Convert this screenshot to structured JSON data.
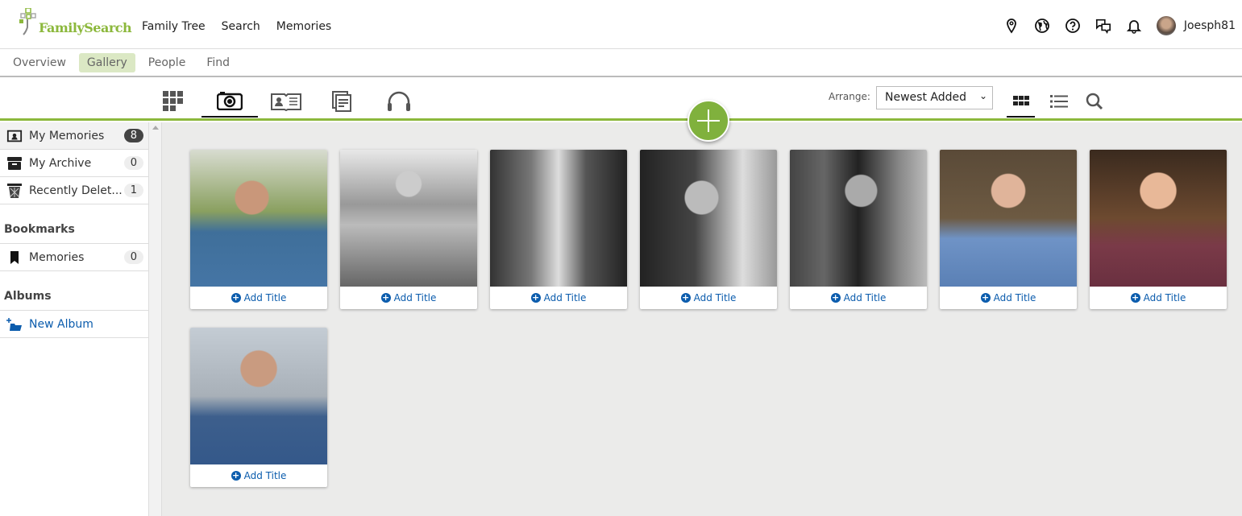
{
  "header": {
    "logo": "FamilySearch",
    "nav": [
      "Family Tree",
      "Search",
      "Memories"
    ],
    "user": "Joesph81",
    "icons": [
      "location-pin-icon",
      "globe-icon",
      "help-icon",
      "chat-icon",
      "bell-icon"
    ]
  },
  "subnav": {
    "items": [
      "Overview",
      "Gallery",
      "People",
      "Find"
    ],
    "active": "Gallery"
  },
  "toolbar": {
    "types": [
      "all-icon",
      "photo-icon",
      "story-icon",
      "document-icon",
      "audio-icon"
    ],
    "arrange_label": "Arrange:",
    "arrange_value": "Newest Added"
  },
  "sidebar": {
    "items": [
      {
        "label": "My Memories",
        "count": "8"
      },
      {
        "label": "My Archive",
        "count": "0"
      },
      {
        "label": "Recently Delet...",
        "count": "1"
      }
    ],
    "bookmarks_heading": "Bookmarks",
    "bookmarks": [
      {
        "label": "Memories",
        "count": "0"
      }
    ],
    "albums_heading": "Albums",
    "new_album": "New Album"
  },
  "gallery": {
    "add_title": "Add Title",
    "count": 8
  }
}
